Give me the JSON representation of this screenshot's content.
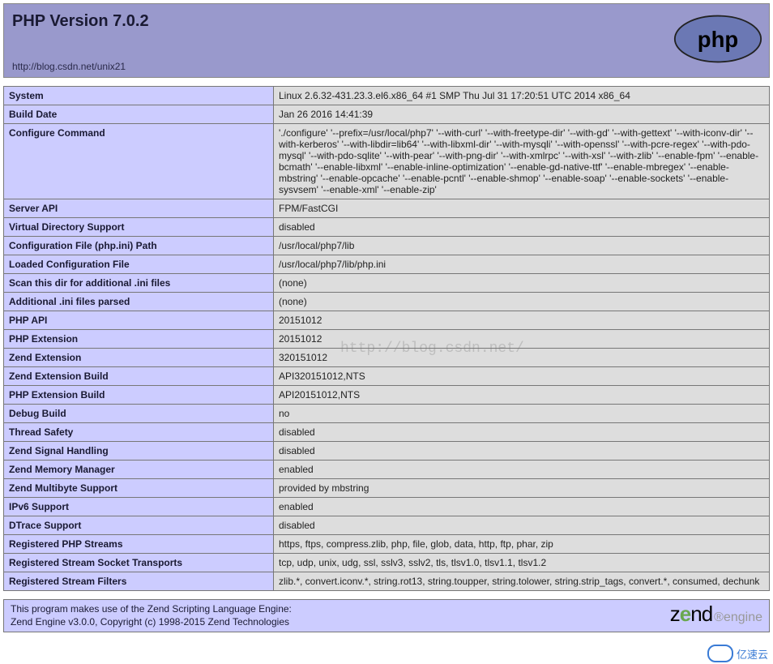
{
  "header": {
    "title": "PHP Version 7.0.2",
    "url": "http://blog.csdn.net/unix21",
    "logo_text": "php"
  },
  "rows": [
    {
      "k": "System",
      "v": "Linux            2.6.32-431.23.3.el6.x86_64 #1 SMP Thu Jul 31 17:20:51 UTC 2014 x86_64"
    },
    {
      "k": "Build Date",
      "v": "Jan 26 2016 14:41:39"
    },
    {
      "k": "Configure Command",
      "v": "'./configure' '--prefix=/usr/local/php7' '--with-curl' '--with-freetype-dir' '--with-gd' '--with-gettext' '--with-iconv-dir' '--with-kerberos' '--with-libdir=lib64' '--with-libxml-dir' '--with-mysqli' '--with-openssl' '--with-pcre-regex' '--with-pdo-mysql' '--with-pdo-sqlite' '--with-pear' '--with-png-dir' '--with-xmlrpc' '--with-xsl' '--with-zlib' '--enable-fpm' '--enable-bcmath' '--enable-libxml' '--enable-inline-optimization' '--enable-gd-native-ttf' '--enable-mbregex' '--enable-mbstring' '--enable-opcache' '--enable-pcntl' '--enable-shmop' '--enable-soap' '--enable-sockets' '--enable-sysvsem' '--enable-xml' '--enable-zip'"
    },
    {
      "k": "Server API",
      "v": "FPM/FastCGI"
    },
    {
      "k": "Virtual Directory Support",
      "v": "disabled"
    },
    {
      "k": "Configuration File (php.ini) Path",
      "v": "/usr/local/php7/lib"
    },
    {
      "k": "Loaded Configuration File",
      "v": "/usr/local/php7/lib/php.ini"
    },
    {
      "k": "Scan this dir for additional .ini files",
      "v": "(none)"
    },
    {
      "k": "Additional .ini files parsed",
      "v": "(none)"
    },
    {
      "k": "PHP API",
      "v": "20151012"
    },
    {
      "k": "PHP Extension",
      "v": "20151012"
    },
    {
      "k": "Zend Extension",
      "v": "320151012"
    },
    {
      "k": "Zend Extension Build",
      "v": "API320151012,NTS"
    },
    {
      "k": "PHP Extension Build",
      "v": "API20151012,NTS"
    },
    {
      "k": "Debug Build",
      "v": "no"
    },
    {
      "k": "Thread Safety",
      "v": "disabled"
    },
    {
      "k": "Zend Signal Handling",
      "v": "disabled"
    },
    {
      "k": "Zend Memory Manager",
      "v": "enabled"
    },
    {
      "k": "Zend Multibyte Support",
      "v": "provided by mbstring"
    },
    {
      "k": "IPv6 Support",
      "v": "enabled"
    },
    {
      "k": "DTrace Support",
      "v": "disabled"
    },
    {
      "k": "Registered PHP Streams",
      "v": "https, ftps, compress.zlib, php, file, glob, data, http, ftp, phar, zip"
    },
    {
      "k": "Registered Stream Socket Transports",
      "v": "tcp, udp, unix, udg, ssl, sslv3, sslv2, tls, tlsv1.0, tlsv1.1, tlsv1.2"
    },
    {
      "k": "Registered Stream Filters",
      "v": "zlib.*, convert.iconv.*, string.rot13, string.toupper, string.tolower, string.strip_tags, convert.*, consumed, dechunk"
    }
  ],
  "footer": {
    "line1": "This program makes use of the Zend Scripting Language Engine:",
    "line2": "Zend Engine v3.0.0, Copyright (c) 1998-2015 Zend Technologies"
  },
  "watermark": "http://blog.csdn.net/",
  "yisu_label": "亿速云"
}
